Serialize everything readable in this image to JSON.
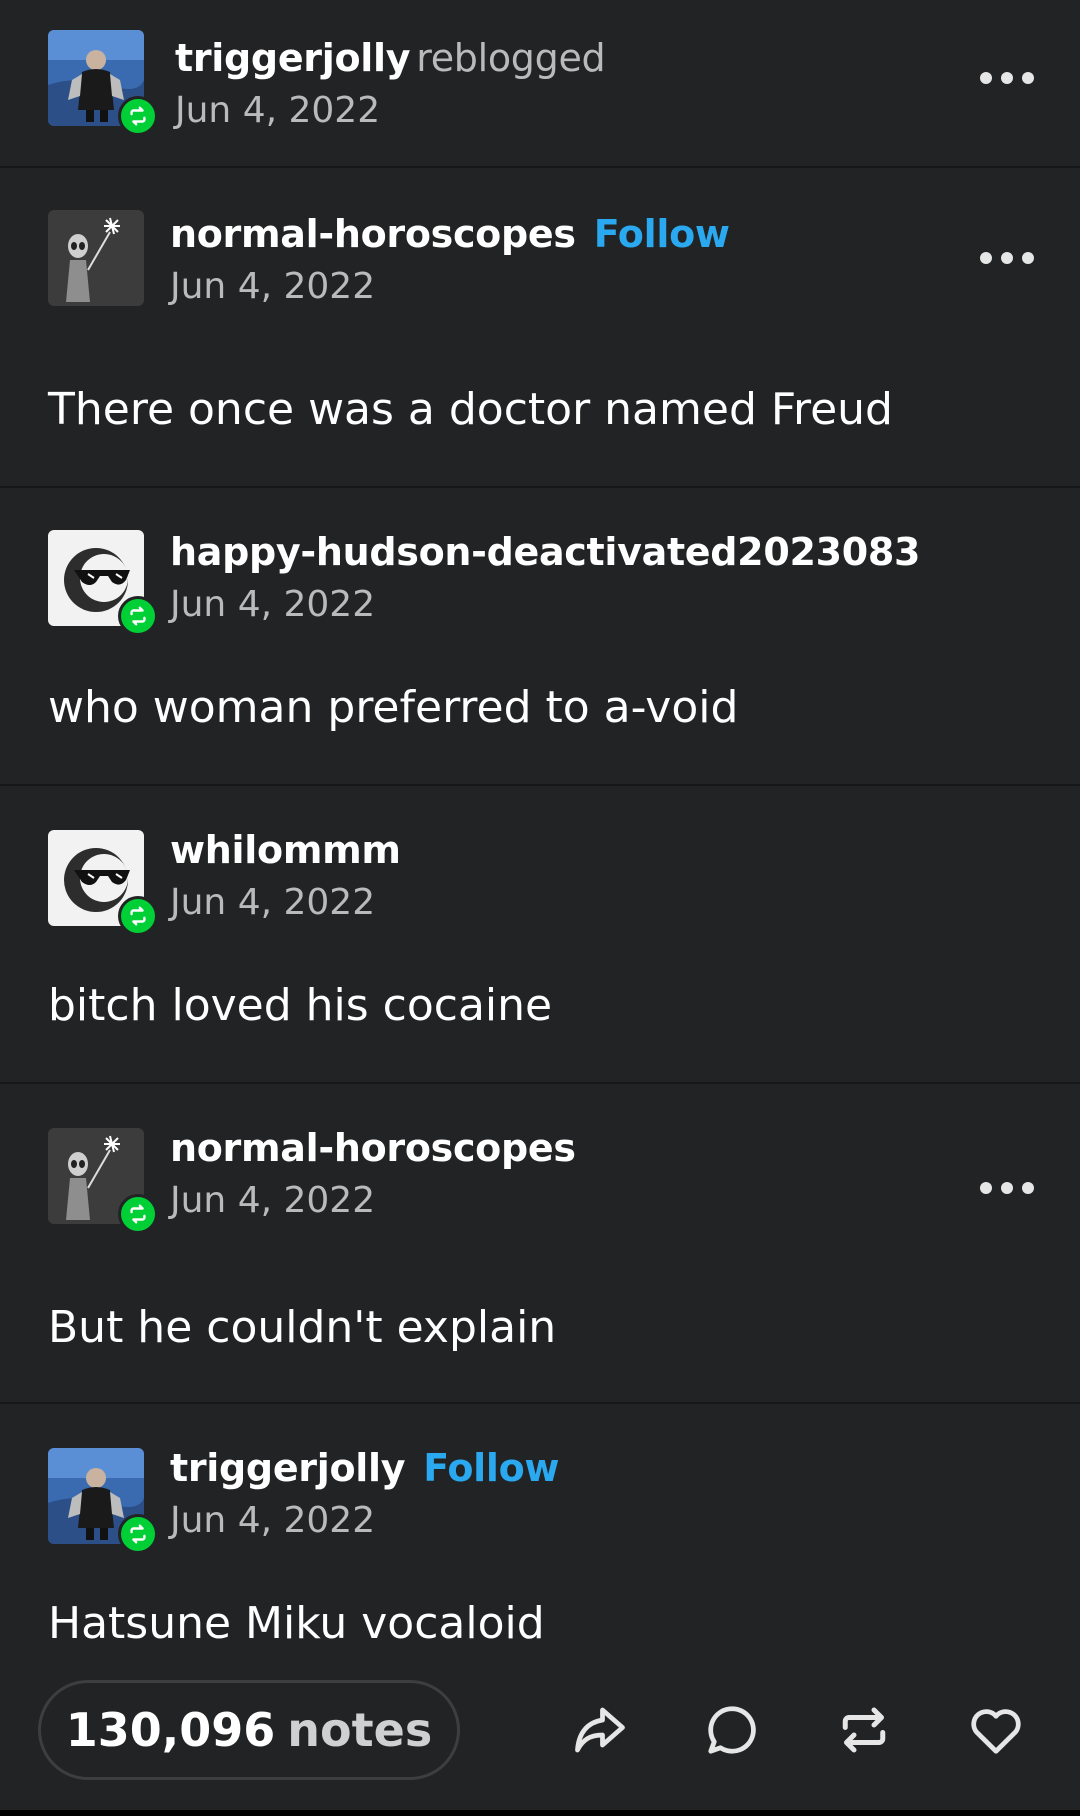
{
  "header": {
    "username": "triggerjolly",
    "action": "reblogged",
    "date": "Jun 4, 2022",
    "avatar_icon": "user-photo-avatar",
    "menu_icon": "more-options-icon"
  },
  "thread": [
    {
      "username": "normal-horoscopes",
      "follow_label": "Follow",
      "date": "Jun 4, 2022",
      "text": "There once was a doctor named Freud",
      "avatar_icon": "alien-avatar"
    },
    {
      "username": "happy-hudson-deactivated2023083",
      "date": "Jun 4, 2022",
      "text": "who woman preferred to a-void",
      "avatar_icon": "sunglasses-face-avatar"
    },
    {
      "username": "whilommm",
      "date": "Jun 4, 2022",
      "text": "bitch loved his cocaine",
      "avatar_icon": "sunglasses-face-avatar"
    },
    {
      "username": "normal-horoscopes",
      "date": "Jun 4, 2022",
      "text": "But he couldn't explain",
      "avatar_icon": "alien-avatar"
    },
    {
      "username": "triggerjolly",
      "follow_label": "Follow",
      "date": "Jun 4, 2022",
      "text": "Hatsune Miku vocaloid",
      "avatar_icon": "user-photo-avatar"
    }
  ],
  "footer": {
    "notes_count": "130,096",
    "notes_label": "notes",
    "share_icon": "share-icon",
    "reply_icon": "reply-icon",
    "reblog_icon": "reblog-icon",
    "like_icon": "heart-icon"
  },
  "colors": {
    "background": "#222324",
    "follow": "#2aa8f0",
    "reblog_badge": "#00cf35",
    "muted_text": "#b9babb"
  }
}
